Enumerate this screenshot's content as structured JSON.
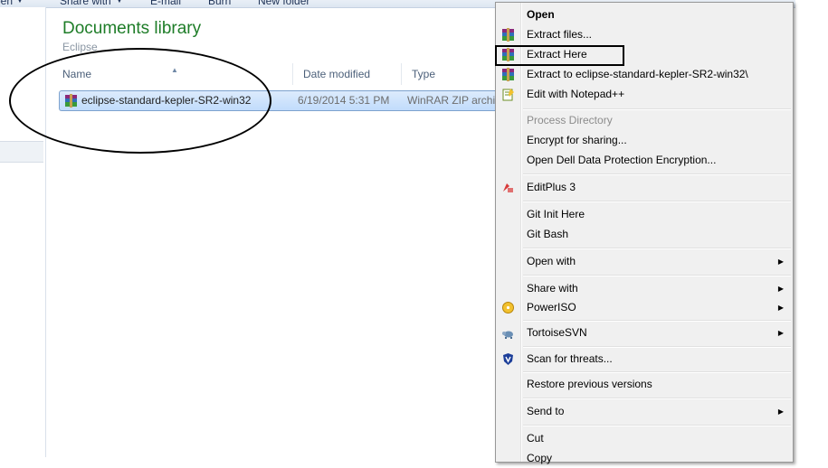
{
  "toolbar": {
    "items": [
      "pen",
      "Share with",
      "E-mail",
      "Burn",
      "New folder"
    ]
  },
  "library": {
    "title": "Documents library",
    "subtitle": "Eclipse"
  },
  "columns": {
    "name": "Name",
    "date": "Date modified",
    "type": "Type"
  },
  "file": {
    "name": "eclipse-standard-kepler-SR2-win32",
    "date": "6/19/2014 5:31 PM",
    "type": "WinRAR ZIP archive",
    "icon": "winrar-archive-icon"
  },
  "context_menu": {
    "items": [
      {
        "label": "Open",
        "bold": true
      },
      {
        "label": "Extract files...",
        "icon": "winrar-icon"
      },
      {
        "label": "Extract Here",
        "icon": "winrar-icon",
        "highlighted": true
      },
      {
        "label": "Extract to eclipse-standard-kepler-SR2-win32\\",
        "icon": "winrar-icon"
      },
      {
        "label": "Edit with Notepad++",
        "icon": "notepadpp-icon"
      },
      {
        "label": "Process Directory",
        "disabled": true
      },
      {
        "label": "Encrypt for sharing..."
      },
      {
        "label": "Open Dell Data Protection Encryption..."
      },
      {
        "label": "EditPlus 3",
        "icon": "editplus-icon"
      },
      {
        "label": "Git Init Here"
      },
      {
        "label": "Git Bash"
      },
      {
        "label": "Open with",
        "submenu": true
      },
      {
        "label": "Share with",
        "submenu": true
      },
      {
        "label": "PowerISO",
        "icon": "poweriso-icon",
        "submenu": true
      },
      {
        "label": "TortoiseSVN",
        "icon": "tortoisesvn-icon",
        "submenu": true
      },
      {
        "label": "Scan for threats...",
        "icon": "shield-icon"
      },
      {
        "label": "Restore previous versions"
      },
      {
        "label": "Send to",
        "submenu": true
      },
      {
        "label": "Cut"
      },
      {
        "label": "Copy"
      }
    ],
    "submenu_glyph": "▶"
  },
  "colors": {
    "library_title": "#1e7d28",
    "selection": "#c1dcfc",
    "menu_bg": "#f0f0f0"
  }
}
